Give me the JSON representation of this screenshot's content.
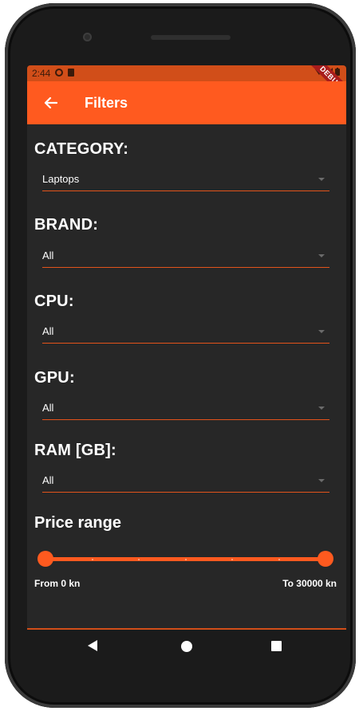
{
  "status_bar": {
    "time": "2:44",
    "debug_banner": "DEBUG",
    "icons": [
      "settings-icon",
      "sim-icon",
      "wifi-icon",
      "signal-icon",
      "battery-icon"
    ]
  },
  "app_bar": {
    "title": "Filters",
    "back_icon": "arrow-left-icon",
    "color": "#ff5a1f"
  },
  "filters": [
    {
      "label": "CATEGORY:",
      "value": "Laptops"
    },
    {
      "label": "BRAND:",
      "value": "All"
    },
    {
      "label": "CPU:",
      "value": "All"
    },
    {
      "label": "GPU:",
      "value": "All"
    },
    {
      "label": "RAM [GB]:",
      "value": "All"
    }
  ],
  "price_range": {
    "title": "Price range",
    "from_label": "From 0 kn",
    "to_label": "To 30000 kn",
    "min": 0,
    "max": 30000
  },
  "colors": {
    "accent": "#ff5a1f",
    "background": "#272727",
    "underline": "#e3531b"
  },
  "nav_bar": {
    "icons": [
      "back-icon",
      "home-icon",
      "recents-icon"
    ]
  }
}
